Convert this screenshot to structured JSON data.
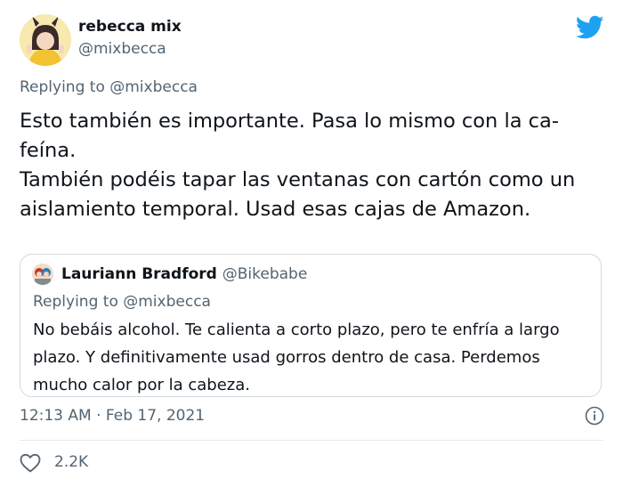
{
  "tweet": {
    "author_name": "rebecca mix",
    "author_handle": "@mixbecca",
    "replying_prefix": "Replying to ",
    "replying_to": "@mixbecca",
    "body_lines": [
      "Esto también es importante. Pasa lo mismo con la ca-",
      "feína.",
      "También podéis tapar las ventanas con cartón como un",
      "aislamiento temporal. Usad esas cajas de Amazon."
    ],
    "timestamp": "12:13 AM · Feb 17, 2021",
    "like_count": "2.2K"
  },
  "quoted": {
    "author_name": "Lauriann Bradford",
    "author_handle": "@Bikebabe",
    "replying_prefix": "Replying to ",
    "replying_to": "@mixbecca",
    "body_lines": [
      "No bebáis alcohol. Te calienta a corto plazo, pero te enfría a largo",
      "plazo. Y definitivamente usad gorros dentro de casa. Perdemos",
      "mucho calor por la cabeza."
    ]
  },
  "colors": {
    "text": "#0f1419",
    "secondary": "#536471",
    "brand_blue": "#1da1f2",
    "border": "#cfd9de"
  },
  "icons": {
    "brand": "twitter-bird-icon",
    "info": "info-icon",
    "like": "heart-icon"
  }
}
